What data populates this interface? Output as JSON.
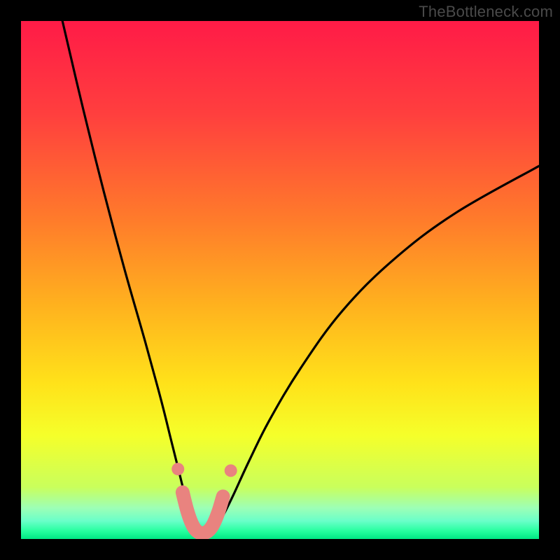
{
  "watermark": "TheBottleneck.com",
  "colors": {
    "black": "#000000",
    "curve": "#000000",
    "marker_fill": "#e9837f",
    "marker_stroke": "#cf6d6a",
    "gradient_stops": [
      {
        "offset": 0.0,
        "color": "#ff1b47"
      },
      {
        "offset": 0.18,
        "color": "#ff3f3e"
      },
      {
        "offset": 0.38,
        "color": "#ff7a2b"
      },
      {
        "offset": 0.55,
        "color": "#ffb21e"
      },
      {
        "offset": 0.7,
        "color": "#ffe21a"
      },
      {
        "offset": 0.8,
        "color": "#f5ff2a"
      },
      {
        "offset": 0.9,
        "color": "#c9ff5c"
      },
      {
        "offset": 0.94,
        "color": "#9dffb6"
      },
      {
        "offset": 0.965,
        "color": "#6affc9"
      },
      {
        "offset": 0.985,
        "color": "#25ff9e"
      },
      {
        "offset": 1.0,
        "color": "#00e884"
      }
    ]
  },
  "chart_data": {
    "type": "line",
    "title": "",
    "xlabel": "",
    "ylabel": "",
    "xlim": [
      0,
      100
    ],
    "ylim": [
      0,
      100
    ],
    "notch_x": 35,
    "left_curve": [
      {
        "x": 8,
        "y": 100
      },
      {
        "x": 12,
        "y": 83
      },
      {
        "x": 16,
        "y": 67
      },
      {
        "x": 20,
        "y": 52
      },
      {
        "x": 24,
        "y": 38
      },
      {
        "x": 27,
        "y": 27
      },
      {
        "x": 29,
        "y": 19
      },
      {
        "x": 30.5,
        "y": 13
      },
      {
        "x": 31.5,
        "y": 9
      },
      {
        "x": 32.5,
        "y": 5.5
      },
      {
        "x": 33.3,
        "y": 3
      },
      {
        "x": 34.2,
        "y": 1.2
      },
      {
        "x": 35,
        "y": 0.5
      }
    ],
    "right_curve": [
      {
        "x": 35,
        "y": 0.5
      },
      {
        "x": 36.2,
        "y": 1.0
      },
      {
        "x": 37.5,
        "y": 2.2
      },
      {
        "x": 39,
        "y": 4.5
      },
      {
        "x": 41,
        "y": 8.5
      },
      {
        "x": 44,
        "y": 15
      },
      {
        "x": 48,
        "y": 23
      },
      {
        "x": 54,
        "y": 33
      },
      {
        "x": 62,
        "y": 44
      },
      {
        "x": 72,
        "y": 54
      },
      {
        "x": 84,
        "y": 63
      },
      {
        "x": 100,
        "y": 72
      }
    ],
    "markers": {
      "dots": [
        {
          "x": 30.3,
          "y": 13.5
        },
        {
          "x": 40.5,
          "y": 13.2
        }
      ],
      "thick_path": [
        {
          "x": 31.2,
          "y": 9.0
        },
        {
          "x": 32.0,
          "y": 5.8
        },
        {
          "x": 32.8,
          "y": 3.4
        },
        {
          "x": 33.6,
          "y": 1.9
        },
        {
          "x": 34.5,
          "y": 1.2
        },
        {
          "x": 35.5,
          "y": 1.2
        },
        {
          "x": 36.4,
          "y": 1.8
        },
        {
          "x": 37.2,
          "y": 3.0
        },
        {
          "x": 38.1,
          "y": 5.2
        },
        {
          "x": 39.0,
          "y": 8.2
        }
      ]
    }
  }
}
